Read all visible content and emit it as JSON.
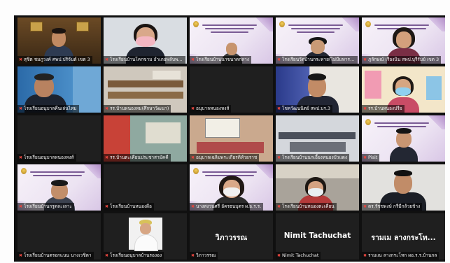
{
  "tiles": [
    "สุชิต ชมภูวงค์ ศพป.ปริจันต์ เขต 3",
    "โรงเรียนบ้านโคกขาม อำเภอพลับพลาชัย",
    "โรงเรียนบ้านนาขนาดกลาง",
    "โรงเรียนวัดบ้านกระทาย(ไม่มีมหารอด)",
    "ภูลักษณ์ เรืองนิน สพป.บุรีรัมย์ เขต 3",
    "โรงเรียนอนุบาลคืนเล่นไหม",
    "รร.บ้านหนองหม(ศึกษาวัฒนา)",
    "อนุบาลหนองหงส์",
    "โชควัฒนนิตย์ สพป.บร.3",
    "รร.บ้านหนองปรือ",
    "โรงเรียนอนุบาลหนองหงส์",
    "รร.บ้านตะเคียนประชาสามัคคี",
    "อนุบาลเฉลิมพระเกียรติห้วยราช",
    "โรงเรียนบ้านนกเอี้ยงหนองบัวแดง",
    "Pisit",
    "โรงเรียนบ้านกรูดละเลาะ",
    "โรงเรียนบ้านหนองผือ",
    "นางสงวนศรี อัครธนบุตร ผ.อ.ร.ร.",
    "โรงเรียนบ้านหนองตะเคียน",
    "ดร.รัชชพงษ์ กรีมีกล้วยช้าง",
    "โรงเรียนบ้านตรอกแนน นางเวชิตา",
    "โรงเรียนอนุบาลบ้านรององ",
    "วิภาวรรณ",
    "Nimit Tachuchat",
    "รามเณ ลางกระโทก ผอ.ร.ร.บ้านกล"
  ],
  "big_names": [
    "วิภาวรรณ",
    "Nimit Tachuchat",
    "รามเม ลางกระโท..."
  ],
  "colors": {
    "mic_muted": "#e5463f",
    "active_border": "#e8e24a",
    "slide_purple": "#7a5b95"
  }
}
